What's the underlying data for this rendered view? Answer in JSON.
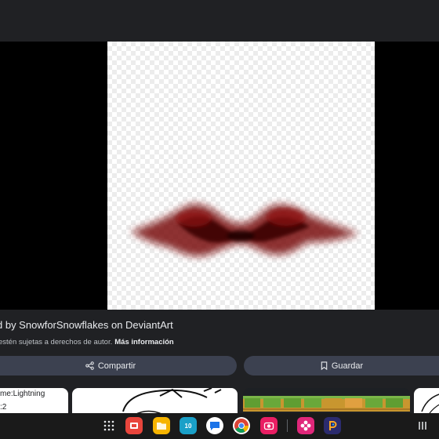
{
  "image": {
    "subject": "red smoke wing shape on transparent background"
  },
  "caption": "d by SnowforSnowflakes on DeviantArt",
  "copyright_notice": "estén sujetas a derechos de autor.",
  "more_info_link": "Más información",
  "actions": {
    "share_label": "Compartir",
    "save_label": "Guardar"
  },
  "related": {
    "thumb1_line1": "me:Lightning",
    "thumb1_line2": ":2"
  },
  "taskbar": {
    "calendar_day": "10",
    "apps": [
      "apps-grid-icon",
      "slides-app-icon",
      "files-app-icon",
      "calendar-app-icon",
      "messages-app-icon",
      "chrome-app-icon",
      "camera-app-icon",
      "flower-app-icon",
      "picsart-app-icon",
      "recents-icon"
    ]
  },
  "colors": {
    "background": "#202124",
    "button": "#3c4150",
    "smoke": "#8b0000"
  }
}
